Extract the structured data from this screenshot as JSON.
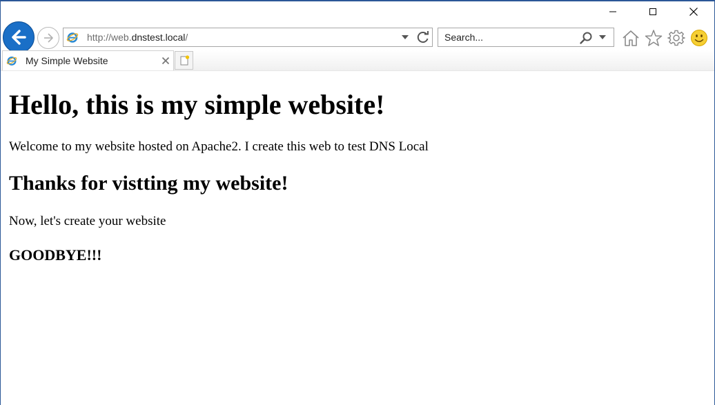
{
  "browser": {
    "address_url_prefix": "http://web.",
    "address_url_host": "dnstest.local",
    "address_url_suffix": "/",
    "search_placeholder": "Search...",
    "accent_color": "#1a6fc7",
    "icons": [
      "back-arrow-icon",
      "forward-arrow-icon",
      "ie-logo-icon",
      "dropdown-arrow-icon",
      "refresh-icon",
      "search-icon",
      "home-icon",
      "favorites-star-icon",
      "settings-gear-icon",
      "feedback-smiley-icon",
      "minimize-icon",
      "maximize-icon",
      "close-icon",
      "new-tab-icon"
    ]
  },
  "tabs": [
    {
      "title": "My Simple Website",
      "active": true
    }
  ],
  "page": {
    "heading": "Hello, this is my simple website!",
    "welcome": "Welcome to my website hosted on Apache2. I create this web to test DNS Local",
    "subheading": "Thanks for vistting my website!",
    "cta": "Now, let's create your website",
    "goodbye": "GOODBYE!!!"
  }
}
